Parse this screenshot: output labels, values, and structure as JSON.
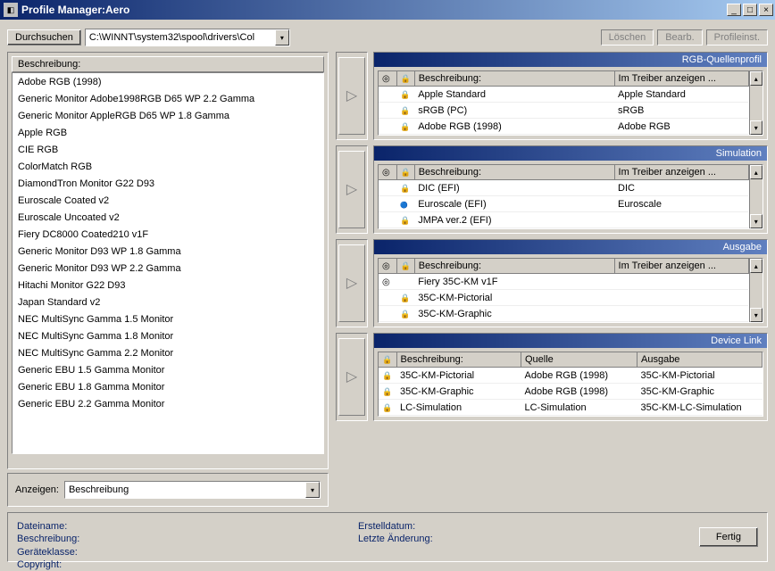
{
  "window": {
    "title": "Profile Manager:Aero"
  },
  "toolbar": {
    "browse": "Durchsuchen",
    "path": "C:\\WINNT\\system32\\spool\\drivers\\Col",
    "delete": "Löschen",
    "edit": "Bearb.",
    "profileinst": "Profileinst."
  },
  "leftlist": {
    "header": "Beschreibung:",
    "items": [
      "Adobe RGB (1998)",
      "Generic Monitor Adobe1998RGB D65 WP 2.2 Gamma",
      "Generic Monitor AppleRGB D65 WP 1.8 Gamma",
      "Apple RGB",
      "CIE RGB",
      "ColorMatch RGB",
      "DiamondTron Monitor G22 D93",
      "Euroscale Coated v2",
      "Euroscale Uncoated v2",
      "Fiery DC8000 Coated210 v1F",
      "Generic Monitor D93 WP 1.8 Gamma",
      "Generic Monitor D93 WP 2.2 Gamma",
      "Hitachi Monitor G22 D93",
      "Japan Standard v2",
      "NEC MultiSync Gamma 1.5 Monitor",
      "NEC MultiSync Gamma 1.8 Monitor",
      "NEC MultiSync Gamma 2.2 Monitor",
      "Generic EBU 1.5 Gamma Monitor",
      "Generic EBU 1.8 Gamma Monitor",
      "Generic EBU 2.2 Gamma Monitor"
    ]
  },
  "anzeigen": {
    "label": "Anzeigen:",
    "value": "Beschreibung"
  },
  "sections": {
    "rgb": {
      "title": "RGB-Quellenprofil",
      "cols": {
        "c1": "Beschreibung:",
        "c2": "Im Treiber anzeigen ..."
      },
      "rows": [
        {
          "desc": "Apple Standard",
          "drv": "Apple Standard"
        },
        {
          "desc": "sRGB (PC)",
          "drv": "sRGB"
        },
        {
          "desc": "Adobe RGB (1998)",
          "drv": "Adobe RGB"
        }
      ]
    },
    "sim": {
      "title": "Simulation",
      "cols": {
        "c1": "Beschreibung:",
        "c2": "Im Treiber anzeigen ..."
      },
      "rows": [
        {
          "desc": "DIC (EFI)",
          "drv": "DIC",
          "icon": "lock"
        },
        {
          "desc": "Euroscale (EFI)",
          "drv": "Euroscale",
          "icon": "flag"
        },
        {
          "desc": "JMPA ver.2 (EFI)",
          "drv": "",
          "icon": "lock"
        }
      ]
    },
    "out": {
      "title": "Ausgabe",
      "cols": {
        "c1": "Beschreibung:",
        "c2": "Im Treiber anzeigen ..."
      },
      "rows": [
        {
          "desc": "Fiery 35C-KM v1F",
          "drv": "",
          "icon": "target"
        },
        {
          "desc": "35C-KM-Pictorial",
          "drv": "",
          "icon": "lock"
        },
        {
          "desc": "35C-KM-Graphic",
          "drv": "",
          "icon": "lock"
        }
      ]
    },
    "dl": {
      "title": "Device Link",
      "cols": {
        "c1": "Beschreibung:",
        "c2": "Quelle",
        "c3": "Ausgabe"
      },
      "rows": [
        {
          "desc": "35C-KM-Pictorial",
          "src": "Adobe RGB (1998)",
          "out": "35C-KM-Pictorial"
        },
        {
          "desc": "35C-KM-Graphic",
          "src": "Adobe RGB (1998)",
          "out": "35C-KM-Graphic"
        },
        {
          "desc": "LC-Simulation",
          "src": "LC-Simulation",
          "out": "35C-KM-LC-Simulation"
        }
      ]
    }
  },
  "info": {
    "filename": "Dateiname:",
    "desc": "Beschreibung:",
    "class": "Geräteklasse:",
    "copyright": "Copyright:",
    "created": "Erstelldatum:",
    "modified": "Letzte Änderung:"
  },
  "done": "Fertig"
}
